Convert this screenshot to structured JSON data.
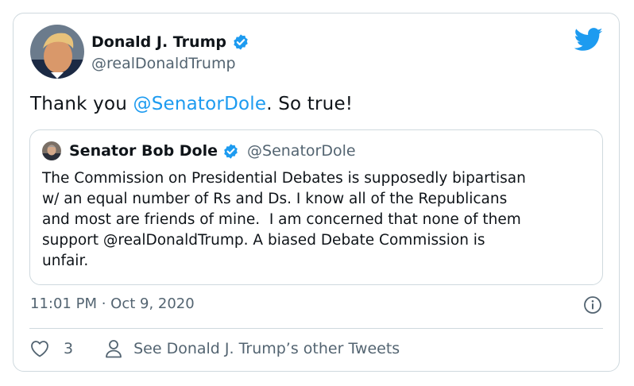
{
  "author": {
    "name": "Donald J. Trump",
    "handle": "@realDonaldTrump"
  },
  "tweet": {
    "prefix": "Thank you ",
    "mention": "@SenatorDole",
    "suffix": ". So true!"
  },
  "quoted": {
    "name": "Senator Bob Dole",
    "handle": "@SenatorDole",
    "text": "The Commission on Presidential Debates is supposedly bipartisan\nw/ an equal number of Rs and Ds. I know all of the Republicans\nand most are friends of mine.  I am concerned that none of them\nsupport @realDonaldTrump. A biased Debate Commission is\nunfair."
  },
  "meta": {
    "timestamp": "11:01 PM · Oct 9, 2020"
  },
  "actions": {
    "like_count": "3",
    "other_tweets_label": "See Donald J. Trump’s other Tweets"
  },
  "icons": {
    "verified": "verified-badge-icon",
    "bird": "twitter-bird-icon",
    "info": "info-icon",
    "heart": "heart-icon",
    "person": "person-icon"
  },
  "colors": {
    "accent": "#1d9bf0",
    "text": "#0f1419",
    "secondary": "#536471",
    "border": "#cfd9de"
  }
}
